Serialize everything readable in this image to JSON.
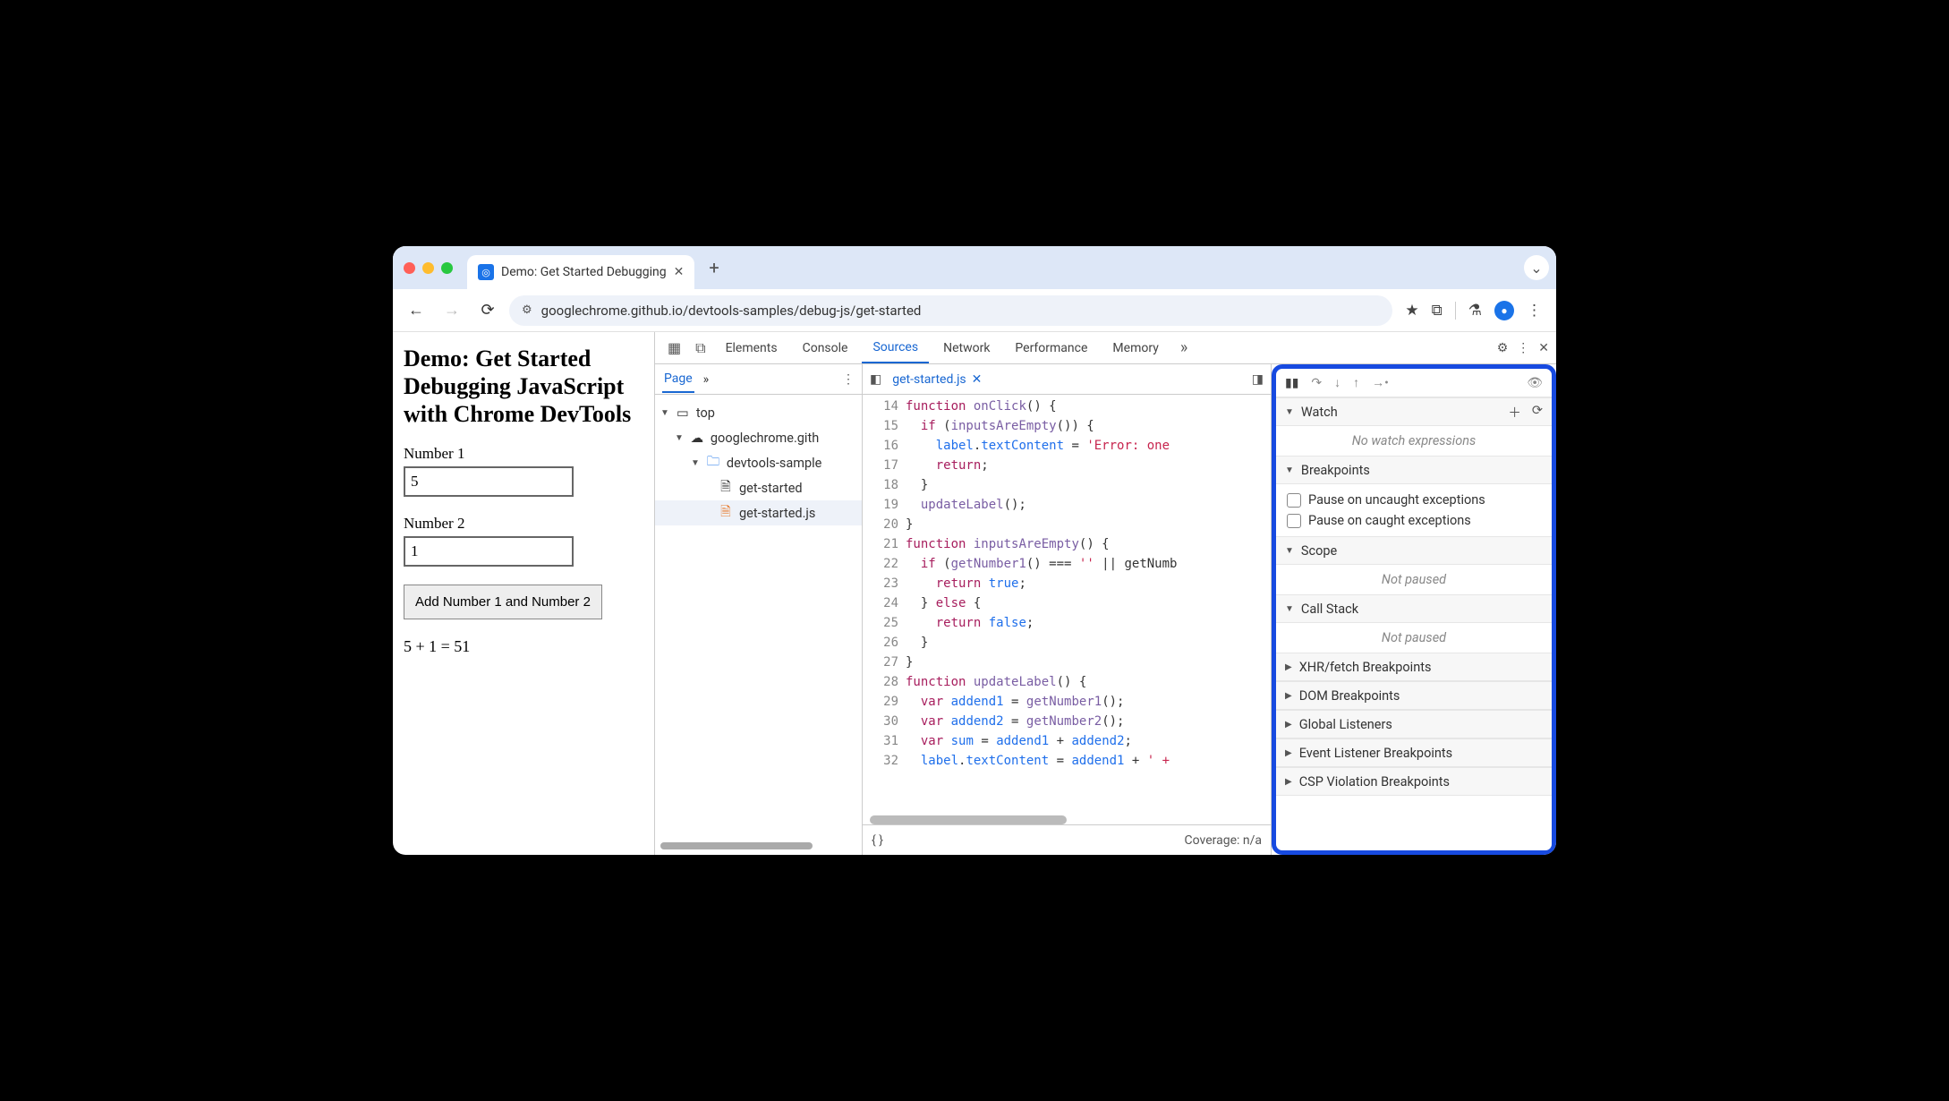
{
  "browser": {
    "tab_title": "Demo: Get Started Debugging",
    "url": "googlechrome.github.io/devtools-samples/debug-js/get-started"
  },
  "page": {
    "heading": "Demo: Get Started Debugging JavaScript with Chrome DevTools",
    "label1": "Number 1",
    "value1": "5",
    "label2": "Number 2",
    "value2": "1",
    "button": "Add Number 1 and Number 2",
    "result": "5 + 1 = 51"
  },
  "devtools": {
    "tabs": [
      "Elements",
      "Console",
      "Sources",
      "Network",
      "Performance",
      "Memory"
    ],
    "active_tab": "Sources",
    "navigator": {
      "tab": "Page",
      "tree": {
        "top": "top",
        "domain": "googlechrome.gith",
        "folder": "devtools-sample",
        "file_html": "get-started",
        "file_js": "get-started.js"
      }
    },
    "editor": {
      "open_file": "get-started.js",
      "coverage": "Coverage: n/a",
      "line_start": 14,
      "lines": [
        "function onClick() {",
        "  if (inputsAreEmpty()) {",
        "    label.textContent = 'Error: one",
        "    return;",
        "  }",
        "  updateLabel();",
        "}",
        "function inputsAreEmpty() {",
        "  if (getNumber1() === '' || getNumb",
        "    return true;",
        "  } else {",
        "    return false;",
        "  }",
        "}",
        "function updateLabel() {",
        "  var addend1 = getNumber1();",
        "  var addend2 = getNumber2();",
        "  var sum = addend1 + addend2;",
        "  label.textContent = addend1 + ' +"
      ]
    },
    "debugger": {
      "watch": {
        "title": "Watch",
        "empty": "No watch expressions"
      },
      "breakpoints": {
        "title": "Breakpoints",
        "opt1": "Pause on uncaught exceptions",
        "opt2": "Pause on caught exceptions"
      },
      "scope": {
        "title": "Scope",
        "empty": "Not paused"
      },
      "callstack": {
        "title": "Call Stack",
        "empty": "Not paused"
      },
      "collapsed": [
        "XHR/fetch Breakpoints",
        "DOM Breakpoints",
        "Global Listeners",
        "Event Listener Breakpoints",
        "CSP Violation Breakpoints"
      ]
    }
  }
}
